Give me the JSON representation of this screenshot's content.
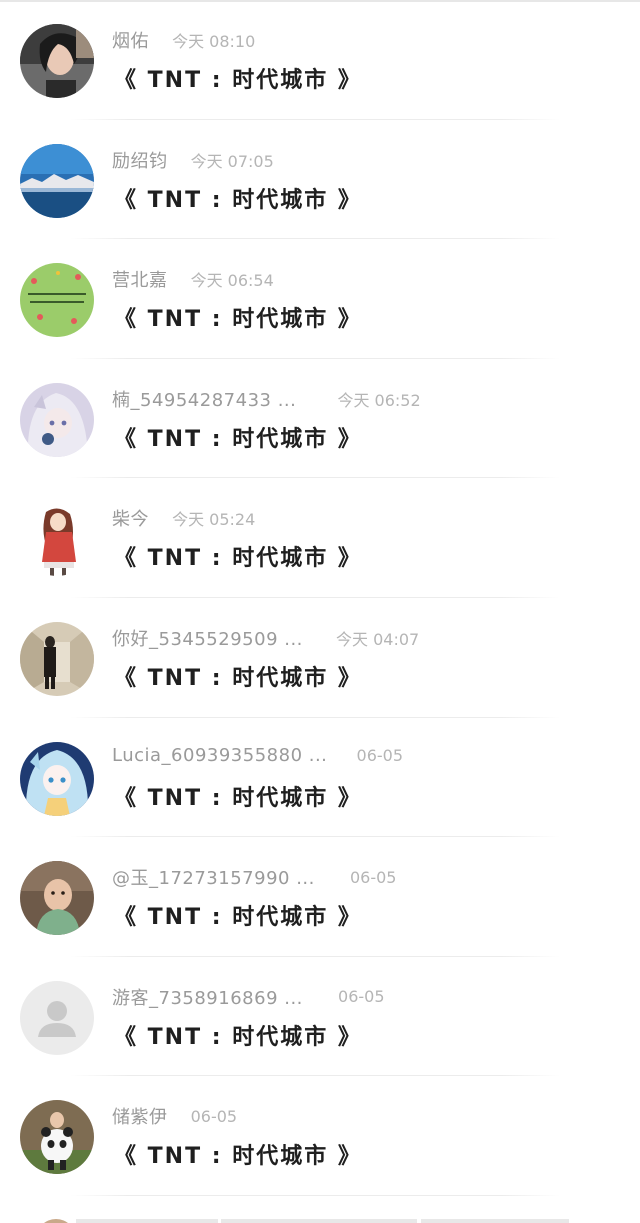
{
  "comments": [
    {
      "name": "烟佑",
      "time": "今天 08:10",
      "text": "《 TNT : 时代城市 》",
      "avatar": "woman-photo-avatar"
    },
    {
      "name": "励绍钧",
      "time": "今天 07:05",
      "text": "《 TNT : 时代城市 》",
      "avatar": "mountain-lake-avatar"
    },
    {
      "name": "营北嘉",
      "time": "今天 06:54",
      "text": "《 TNT : 时代城市 》",
      "avatar": "green-text-avatar"
    },
    {
      "name": "楠_54954287433 ...",
      "time": "今天 06:52",
      "text": "《 TNT : 时代城市 》",
      "avatar": "anime-silver-hair-avatar"
    },
    {
      "name": "柴今",
      "time": "今天 05:24",
      "text": "《 TNT : 时代城市 》",
      "avatar": "anime-girl-red-coat-avatar"
    },
    {
      "name": "你好_5345529509 ...",
      "time": "今天 04:07",
      "text": "《 TNT : 时代城市 》",
      "avatar": "corridor-figure-avatar"
    },
    {
      "name": "Lucia_60939355880 ...",
      "time": "06-05",
      "text": "《 TNT : 时代城市 》",
      "avatar": "anime-blue-hair-avatar"
    },
    {
      "name": "@玉_17273157990 ...",
      "time": "06-05",
      "text": "《 TNT : 时代城市 》",
      "avatar": "baby-photo-avatar"
    },
    {
      "name": "游客_7358916869 ...",
      "time": "06-05",
      "text": "《 TNT : 时代城市 》",
      "avatar": "default-user-avatar"
    },
    {
      "name": "储紫伊",
      "time": "06-05",
      "text": "《 TNT : 时代城市 》",
      "avatar": "panda-costume-avatar"
    }
  ],
  "colors": {
    "name": "#9a9a9a",
    "time": "#b5b5b5",
    "text": "#1f1f1f",
    "divider": "#ececec"
  }
}
